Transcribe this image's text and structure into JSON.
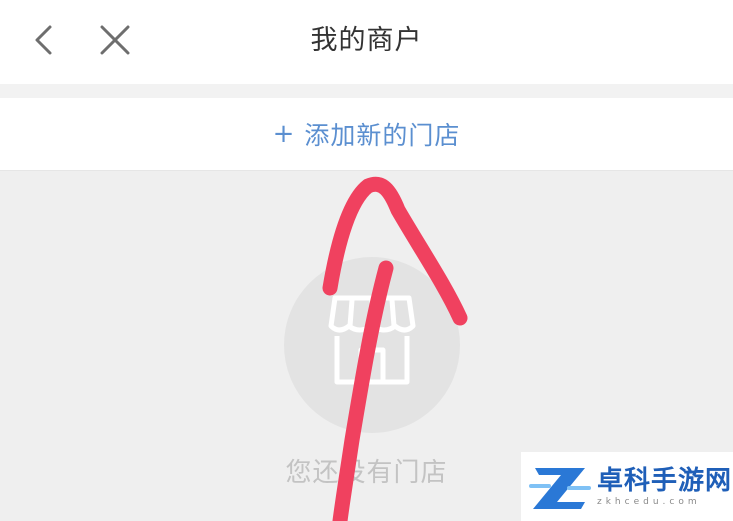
{
  "header": {
    "title": "我的商户",
    "back_icon": "chevron-left-icon",
    "close_icon": "close-icon"
  },
  "actions": {
    "add_store_plus": "+",
    "add_store_label": "添加新的门店",
    "accent_color": "#5b8fd0"
  },
  "empty_state": {
    "icon": "store-icon",
    "message": "您还没有门店"
  },
  "annotation": {
    "type": "red-hand-drawn-arrow",
    "color": "#f0415f"
  },
  "watermark": {
    "brand": "卓科手游网",
    "url": "zkhcedu.com",
    "brand_color": "#1f5fb8"
  }
}
